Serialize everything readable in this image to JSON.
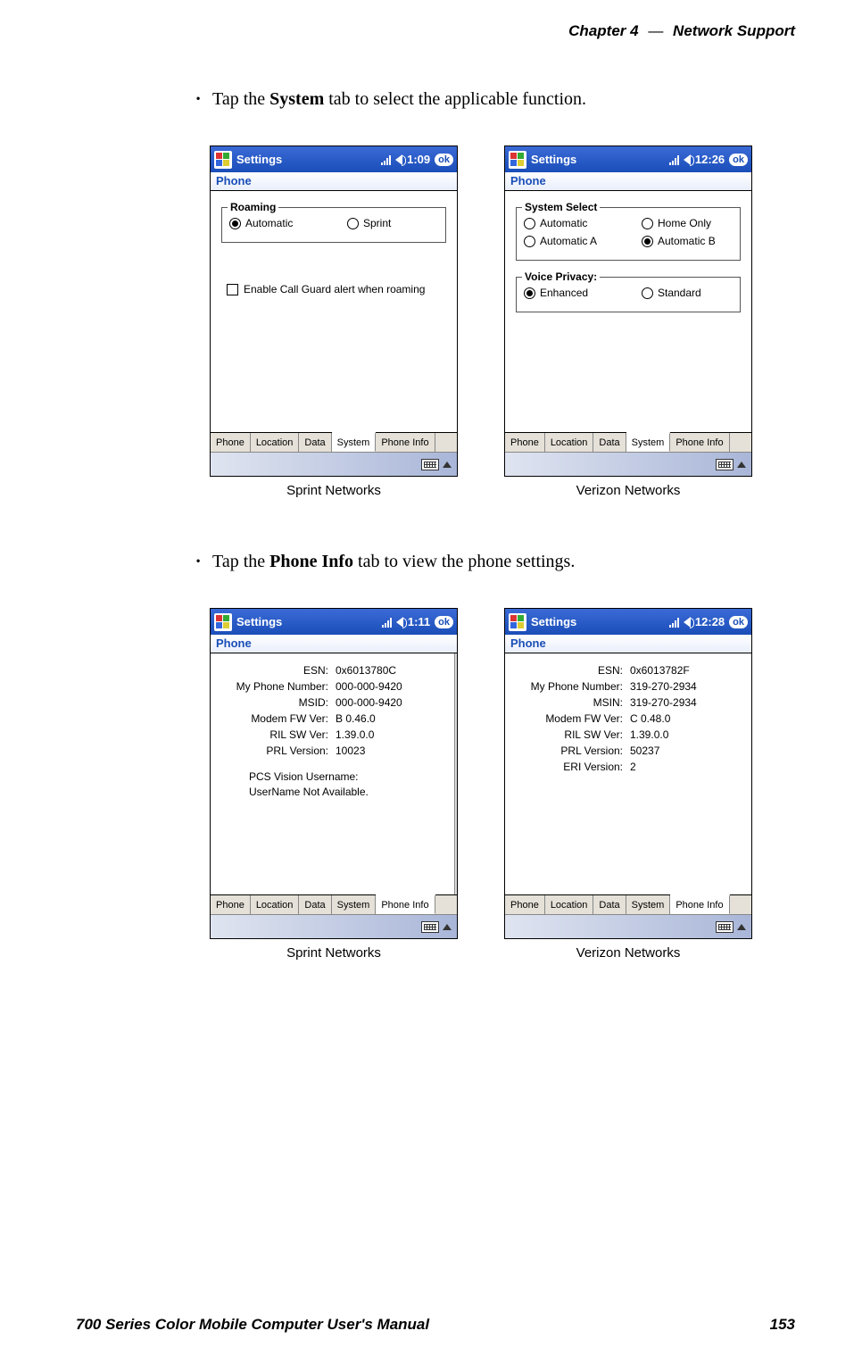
{
  "header": {
    "chapter": "Chapter  4",
    "dash": "—",
    "title": "Network Support"
  },
  "bullets": {
    "system_pre": "Tap the ",
    "system_bold": "System",
    "system_post": " tab to select the applicable function.",
    "phoneinfo_pre": "Tap the ",
    "phoneinfo_bold": "Phone Info",
    "phoneinfo_post": " tab to view the phone settings."
  },
  "labels": {
    "settings": "Settings",
    "phone": "Phone",
    "ok": "ok",
    "sprint_caption": "Sprint Networks",
    "verizon_caption": "Verizon Networks"
  },
  "tabs": [
    "Phone",
    "Location",
    "Data",
    "System",
    "Phone Info"
  ],
  "screen1": {
    "time": "1:09",
    "roaming_legend": "Roaming",
    "r1": "Automatic",
    "r2": "Sprint",
    "cb_text": "Enable Call Guard alert when roaming",
    "active_tab": 3
  },
  "screen2": {
    "time": "12:26",
    "sys_legend": "System Select",
    "s1": "Automatic",
    "s2": "Home Only",
    "s3": "Automatic A",
    "s4": "Automatic B",
    "vp_legend": "Voice Privacy:",
    "v1": "Enhanced",
    "v2": "Standard",
    "active_tab": 3
  },
  "screen3": {
    "time": "1:11",
    "rows": [
      {
        "k": "ESN:",
        "v": "0x6013780C"
      },
      {
        "k": "My Phone Number:",
        "v": "000-000-9420"
      },
      {
        "k": "MSID:",
        "v": "000-000-9420"
      },
      {
        "k": "Modem FW Ver:",
        "v": "B 0.46.0"
      },
      {
        "k": "RIL SW Ver:",
        "v": "1.39.0.0"
      },
      {
        "k": "PRL Version:",
        "v": "10023"
      }
    ],
    "extra1": "PCS Vision Username:",
    "extra2": "UserName Not Available.",
    "active_tab": 4
  },
  "screen4": {
    "time": "12:28",
    "rows": [
      {
        "k": "ESN:",
        "v": "0x6013782F"
      },
      {
        "k": "My Phone Number:",
        "v": "319-270-2934"
      },
      {
        "k": "MSIN:",
        "v": "319-270-2934"
      },
      {
        "k": "Modem FW Ver:",
        "v": "C 0.48.0"
      },
      {
        "k": "RIL SW Ver:",
        "v": "1.39.0.0"
      },
      {
        "k": "PRL Version:",
        "v": "50237"
      },
      {
        "k": "ERI Version:",
        "v": "2"
      }
    ],
    "active_tab": 4
  },
  "footer": {
    "manual": "700 Series Color Mobile Computer User's Manual",
    "page": "153"
  }
}
